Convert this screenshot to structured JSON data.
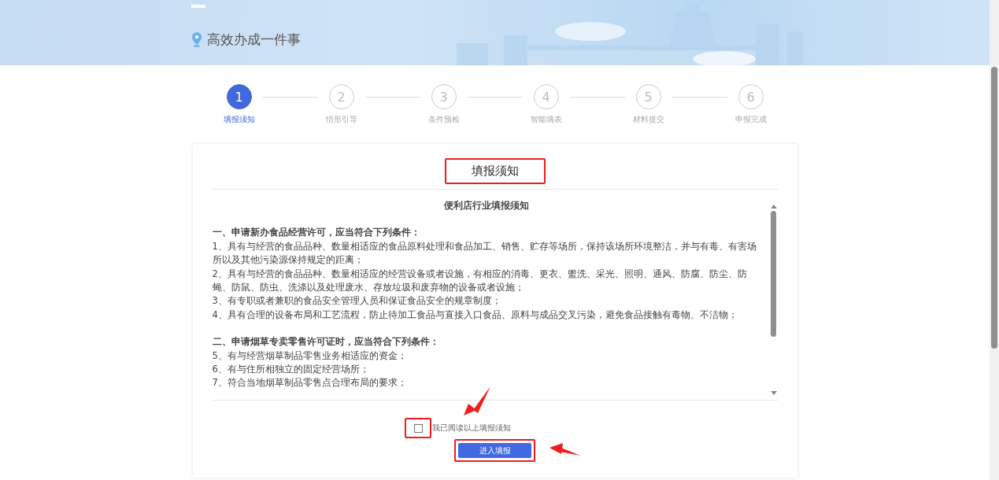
{
  "header": {
    "title": "高效办成一件事"
  },
  "steps": [
    {
      "number": "1",
      "label": "填报须知",
      "selected": true
    },
    {
      "number": "2",
      "label": "情形引导",
      "selected": false
    },
    {
      "number": "3",
      "label": "条件预检",
      "selected": false
    },
    {
      "number": "4",
      "label": "智能填表",
      "selected": false
    },
    {
      "number": "5",
      "label": "材料提交",
      "selected": false
    },
    {
      "number": "6",
      "label": "申报完成",
      "selected": false
    }
  ],
  "notice": {
    "title": "填报须知",
    "document_title": "便利店行业填报须知",
    "sections": [
      {
        "heading": "一、申请新办食品经营许可，应当符合下列条件：",
        "items": [
          "1、具有与经营的食品品种、数量相适应的食品原料处理和食品加工、销售、贮存等场所，保持该场所环境整洁，并与有毒、有害场所以及其他污染源保持规定的距离；",
          "2、具有与经营的食品品种、数量相适应的经营设备或者设施，有相应的消毒、更衣、盥洗、采光、照明、通风、防腐、防尘、防蝇、防鼠、防虫、洗涤以及处理废水、存放垃圾和废弃物的设备或者设施；",
          "3、有专职或者兼职的食品安全管理人员和保证食品安全的规章制度；",
          "4、具有合理的设备布局和工艺流程，防止待加工食品与直接入口食品、原料与成品交叉污染，避免食品接触有毒物、不洁物；"
        ]
      },
      {
        "heading": "二、申请烟草专卖零售许可证时，应当符合下列条件：",
        "items": [
          "5、有与经营烟草制品零售业务相适应的资金；",
          "6、有与住所相独立的固定经营场所；",
          "7、符合当地烟草制品零售点合理布局的要求；"
        ]
      }
    ]
  },
  "agreement": {
    "label": "我已阅读以上填报须知",
    "checked": false
  },
  "submit_button": "进入填报"
}
